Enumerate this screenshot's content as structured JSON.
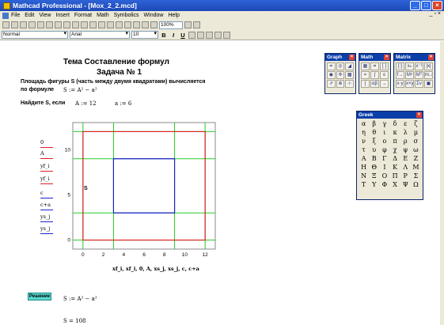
{
  "window": {
    "title": "Mathcad Professional - [Mox_2_2.mcd]"
  },
  "menu": [
    "File",
    "Edit",
    "View",
    "Insert",
    "Format",
    "Math",
    "Symbolics",
    "Window",
    "Help"
  ],
  "toolbar": {
    "zoom": "100%"
  },
  "format_bar": {
    "style": "Normal",
    "font": "Arial",
    "size": "10",
    "bold": "B",
    "italic": "I",
    "underline": "U"
  },
  "doc": {
    "title": "Тема Составление формул",
    "subtitle": "Задача № 1",
    "line1": "Площадь фигуры S (часть между двумя квадратами) вычисляется",
    "line2": "по формуле",
    "formula": "S := A² − a²",
    "find": "Найдите S, если",
    "A_def": "A := 12",
    "a_def": "a := 6",
    "solution_button": "Решение",
    "solution_formula": "S := A² − a²",
    "result": "S = 108"
  },
  "plot": {
    "legend": [
      "0",
      "A",
      "yf_i",
      "yf_i",
      "c",
      "c+a",
      "ys_j",
      "ys_j"
    ],
    "legend_colors": [
      "#e02020",
      "#e02020",
      "#e02020",
      "#e02020",
      "#2020d0",
      "#2020d0",
      "#2020d0",
      "#2020d0"
    ],
    "xlabel": "xf_i, xf_i, 0, A, xs_j, xs_j, c, c+a",
    "inner_label": "S"
  },
  "chart_data": {
    "type": "line",
    "xlim": [
      -1,
      13
    ],
    "ylim": [
      -1,
      13
    ],
    "x_ticks": [
      "0",
      "2",
      "4",
      "6",
      "8",
      "10",
      "12"
    ],
    "y_ticks": [
      "0",
      "5",
      "10"
    ],
    "grid": true,
    "series": [
      {
        "values": [
          [
            0,
            0
          ],
          [
            12,
            0
          ],
          [
            12,
            12
          ],
          [
            0,
            12
          ],
          [
            0,
            0
          ]
        ],
        "color": "#e02020"
      },
      {
        "values": [
          [
            3,
            3
          ],
          [
            9,
            3
          ],
          [
            9,
            9
          ],
          [
            3,
            9
          ],
          [
            3,
            3
          ]
        ],
        "color": "#2020d0"
      }
    ],
    "gridlines": {
      "x": [
        0,
        3,
        9,
        12
      ],
      "y": [
        0,
        3,
        9,
        12
      ],
      "color": "#22cc22"
    }
  },
  "palettes": {
    "graph": {
      "title": "Graph"
    },
    "math": {
      "title": "Math"
    },
    "matrix": {
      "title": "Matrix"
    },
    "greek": {
      "title": "Greek",
      "letters": [
        "α",
        "β",
        "γ",
        "δ",
        "ε",
        "ζ",
        "η",
        "θ",
        "ι",
        "κ",
        "λ",
        "μ",
        "ν",
        "ξ",
        "ο",
        "π",
        "ρ",
        "σ",
        "τ",
        "υ",
        "φ",
        "χ",
        "ψ",
        "ω",
        "Α",
        "Β",
        "Γ",
        "Δ",
        "Ε",
        "Ζ",
        "Η",
        "Θ",
        "Ι",
        "Κ",
        "Λ",
        "Μ",
        "Ν",
        "Ξ",
        "Ο",
        "Π",
        "Ρ",
        "Σ",
        "Τ",
        "Υ",
        "Φ",
        "Χ",
        "Ψ",
        "Ω"
      ]
    }
  }
}
